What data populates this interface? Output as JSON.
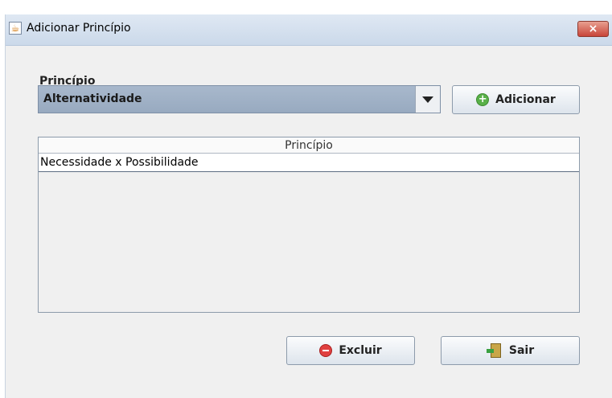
{
  "window": {
    "title": "Adicionar Princípio",
    "app_icon": "java-icon",
    "close_label": "×"
  },
  "form": {
    "field_label": "Princípio",
    "combo_value": "Alternatividade",
    "add_button": "Adicionar"
  },
  "table": {
    "header": "Princípio",
    "rows": [
      {
        "principio": "Necessidade x Possibilidade"
      }
    ]
  },
  "actions": {
    "delete_button": "Excluir",
    "exit_button": "Sair"
  },
  "colors": {
    "accent": "#98aac0",
    "close": "#c8453a",
    "add_icon": "#58b048",
    "delete_icon": "#e04040"
  }
}
